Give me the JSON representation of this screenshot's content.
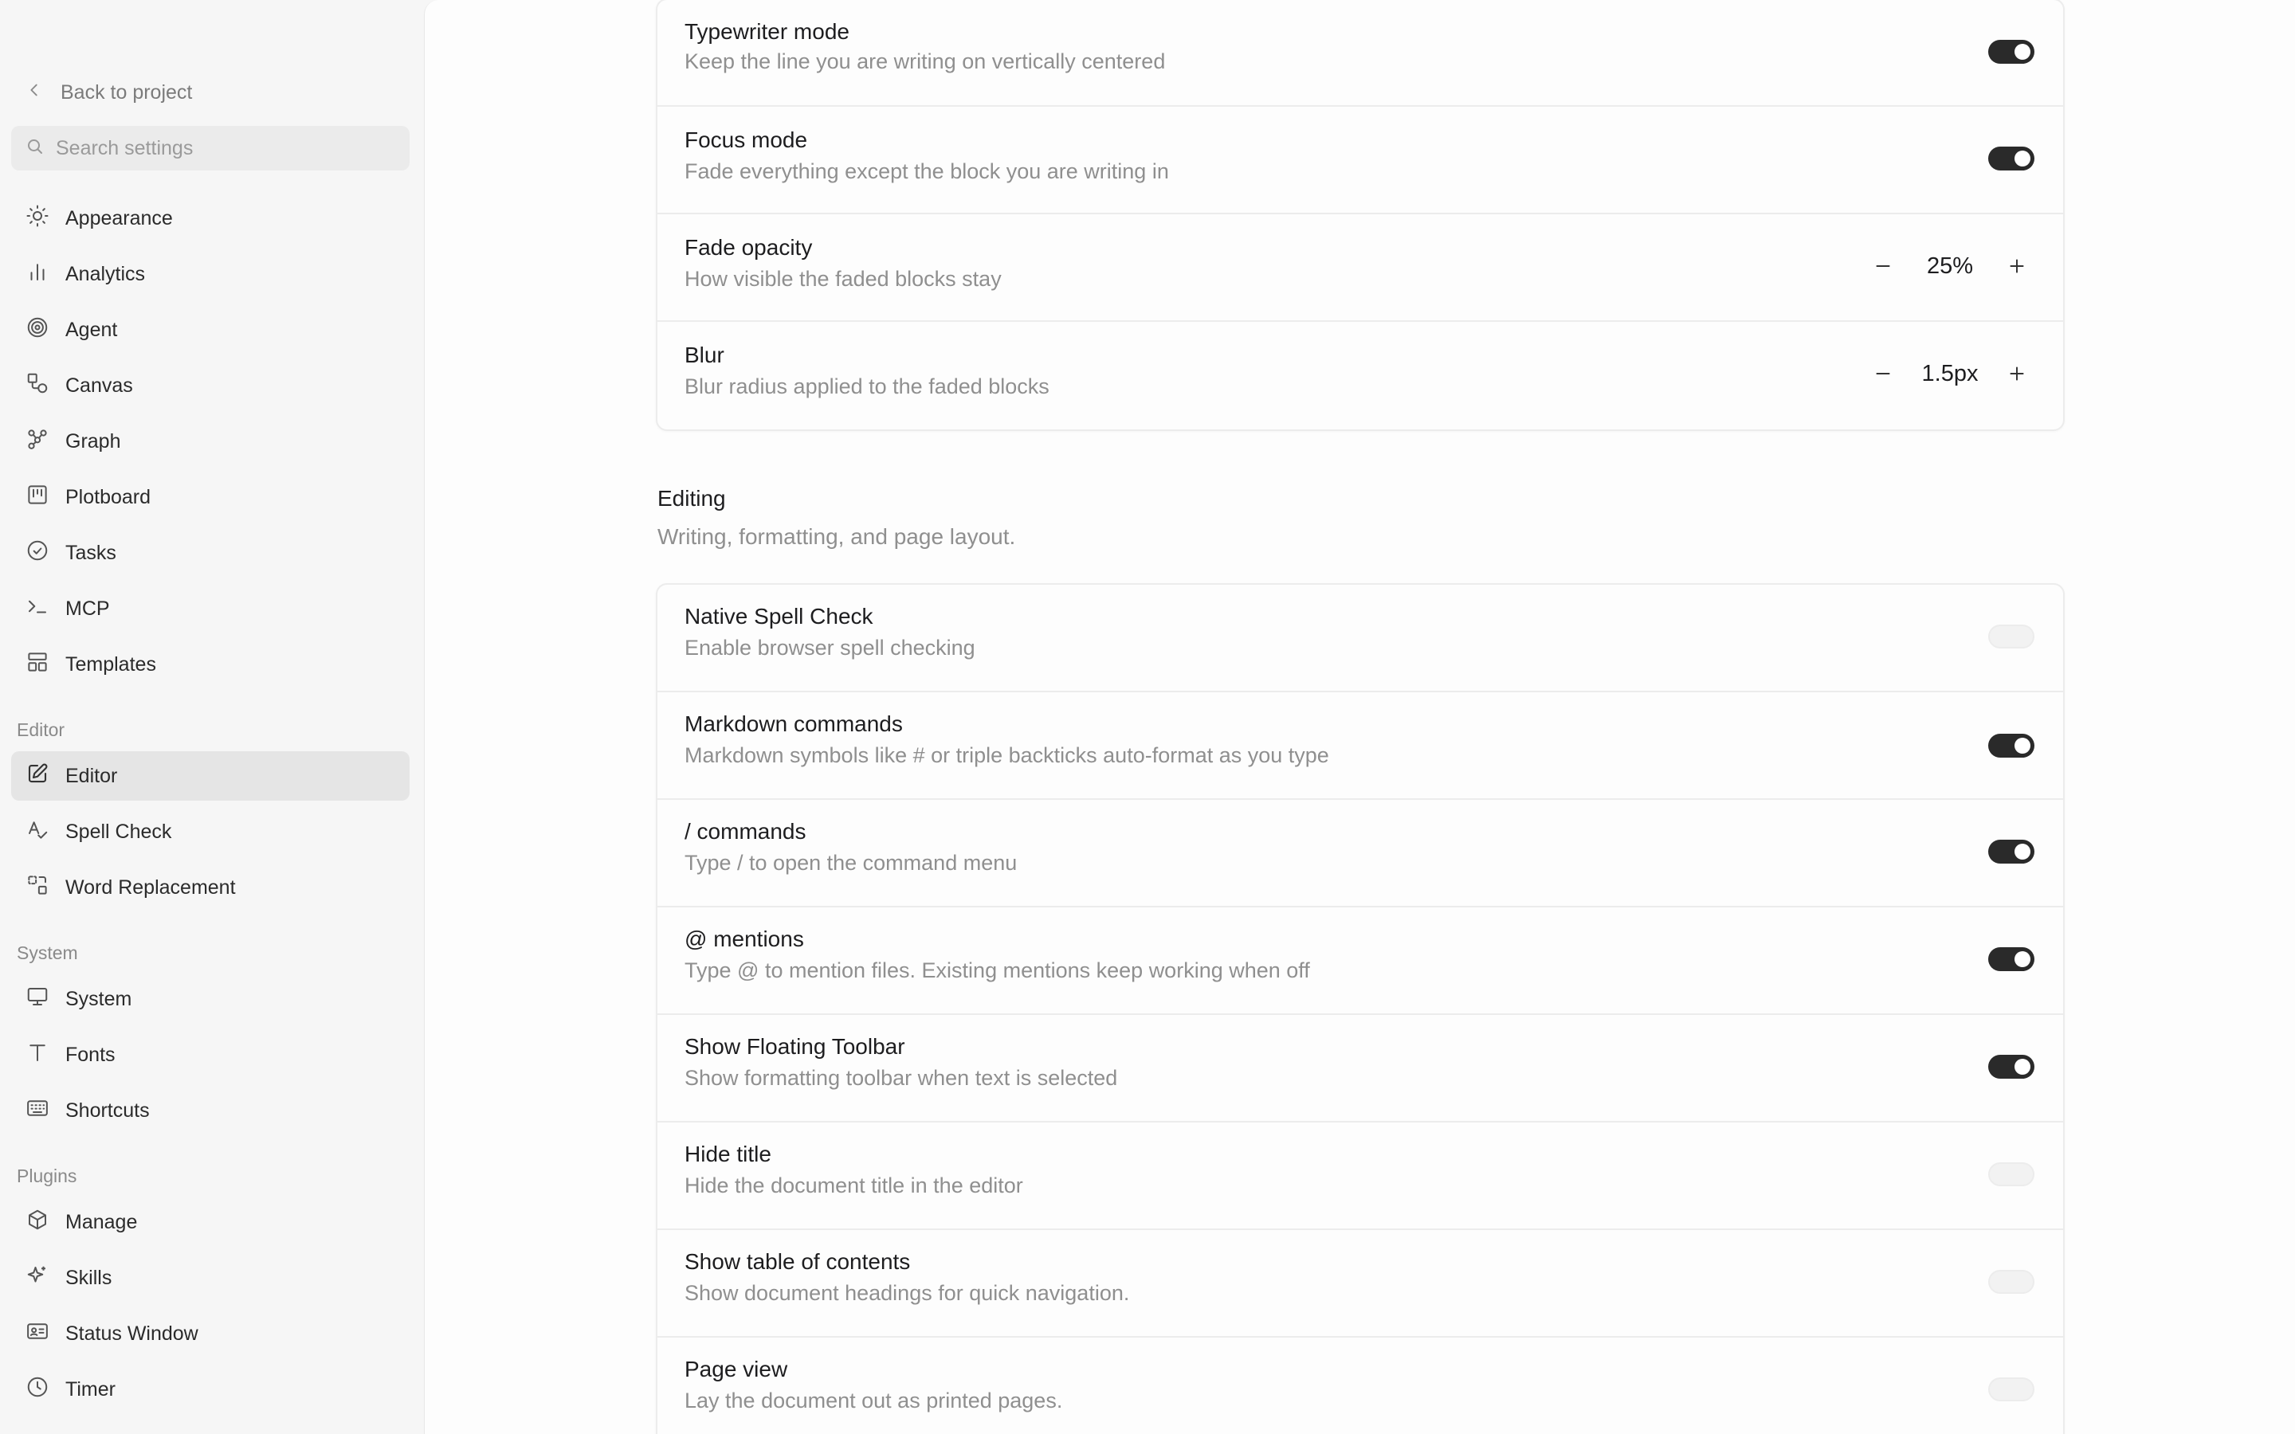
{
  "sidebar": {
    "back_label": "Back to project",
    "search_placeholder": "Search settings",
    "items_top": [
      {
        "label": "Appearance",
        "icon": "sun-icon"
      },
      {
        "label": "Analytics",
        "icon": "bar-chart-icon"
      },
      {
        "label": "Agent",
        "icon": "spiral-icon"
      },
      {
        "label": "Canvas",
        "icon": "shapes-icon"
      },
      {
        "label": "Graph",
        "icon": "graph-icon"
      },
      {
        "label": "Plotboard",
        "icon": "kanban-icon"
      },
      {
        "label": "Tasks",
        "icon": "check-circle-icon"
      },
      {
        "label": "MCP",
        "icon": "terminal-icon"
      },
      {
        "label": "Templates",
        "icon": "layout-icon"
      }
    ],
    "section_editor": "Editor",
    "items_editor": [
      {
        "label": "Editor",
        "icon": "pencil-square-icon",
        "active": true
      },
      {
        "label": "Spell Check",
        "icon": "spell-check-icon"
      },
      {
        "label": "Word Replacement",
        "icon": "replace-icon"
      }
    ],
    "section_system": "System",
    "items_system": [
      {
        "label": "System",
        "icon": "monitor-icon"
      },
      {
        "label": "Fonts",
        "icon": "type-icon"
      },
      {
        "label": "Shortcuts",
        "icon": "keyboard-icon"
      }
    ],
    "section_plugins": "Plugins",
    "items_plugins": [
      {
        "label": "Manage",
        "icon": "package-icon"
      },
      {
        "label": "Skills",
        "icon": "sparkles-icon"
      },
      {
        "label": "Status Window",
        "icon": "id-card-icon"
      },
      {
        "label": "Timer",
        "icon": "clock-icon"
      }
    ]
  },
  "focus_card": {
    "rows": [
      {
        "title": "Typewriter mode",
        "desc": "Keep the line you are writing on vertically centered",
        "control": "toggle",
        "on": true
      },
      {
        "title": "Focus mode",
        "desc": "Fade everything except the block you are writing in",
        "control": "toggle",
        "on": true
      },
      {
        "title": "Fade opacity",
        "desc": "How visible the faded blocks stay",
        "control": "stepper",
        "value": "25%"
      },
      {
        "title": "Blur",
        "desc": "Blur radius applied to the faded blocks",
        "control": "stepper",
        "value": "1.5px"
      }
    ]
  },
  "editing": {
    "title": "Editing",
    "desc": "Writing, formatting, and page layout.",
    "rows": [
      {
        "title": "Native Spell Check",
        "desc": "Enable browser spell checking",
        "on": false
      },
      {
        "title": "Markdown commands",
        "desc": "Markdown symbols like # or triple backticks auto-format as you type",
        "on": true
      },
      {
        "title": "/ commands",
        "desc": "Type / to open the command menu",
        "on": true
      },
      {
        "title": "@ mentions",
        "desc": "Type @ to mention files. Existing mentions keep working when off",
        "on": true
      },
      {
        "title": "Show Floating Toolbar",
        "desc": "Show formatting toolbar when text is selected",
        "on": true
      },
      {
        "title": "Hide title",
        "desc": "Hide the document title in the editor",
        "on": false
      },
      {
        "title": "Show table of contents",
        "desc": "Show document headings for quick navigation.",
        "on": false
      },
      {
        "title": "Page view",
        "desc": "Lay the document out as printed pages.",
        "on": false
      }
    ]
  },
  "colors": {
    "toggle_on": "#2a2a2a",
    "toggle_off": "#f2f2f2",
    "active_nav": "#e5e5e5"
  }
}
